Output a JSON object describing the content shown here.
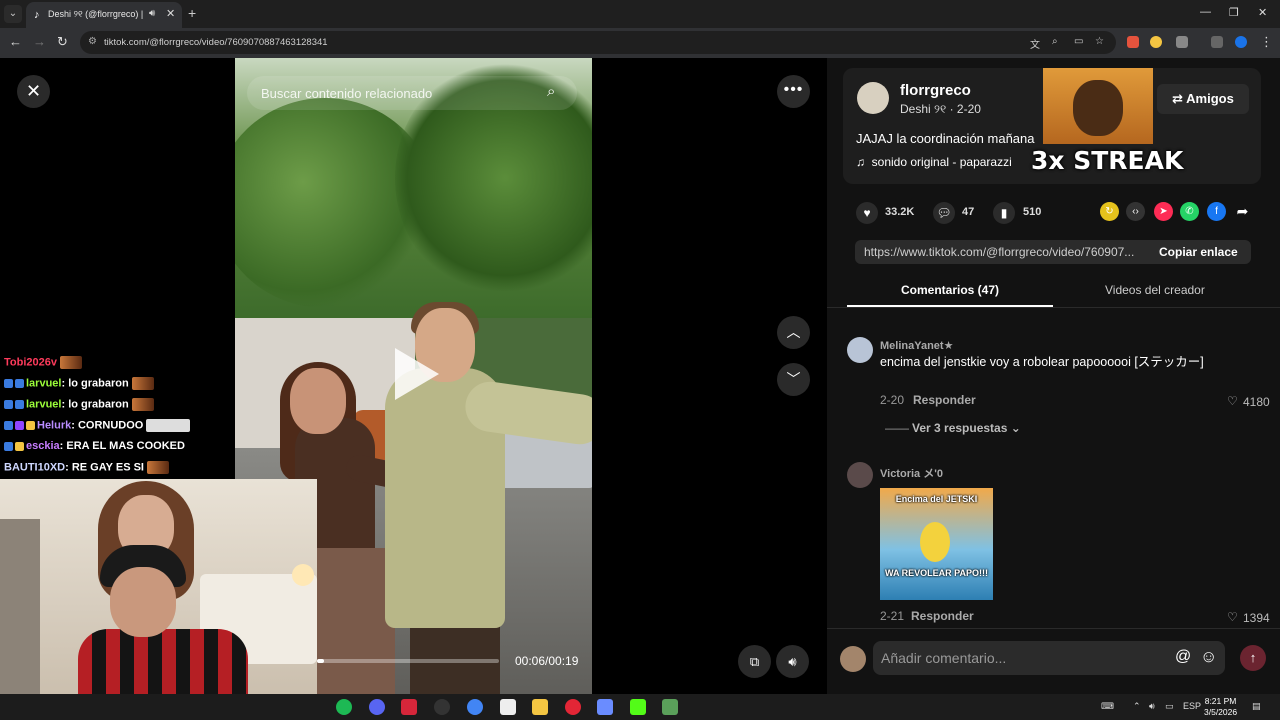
{
  "browser": {
    "tab_title": "Deshi ୨୧ (@florrgreco) | Tik",
    "url": "tiktok.com/@florrgreco/video/7609070887463128341"
  },
  "video": {
    "search_placeholder": "Buscar contenido relacionado",
    "time": "00:06/00:19",
    "progress_fraction": 0.04
  },
  "post": {
    "username": "florrgreco",
    "subline": "Deshi ୨୧ · 2-20",
    "friends_label": "Amigos",
    "caption": "JAJAJ la coordinación mañana",
    "sound": "sonido original - paparazzi",
    "likes": "33.2K",
    "comments": "47",
    "saves": "510",
    "link": "https://www.tiktok.com/@florrgreco/video/760907...",
    "copy_label": "Copiar enlace"
  },
  "overlay": {
    "streak": "3x STREAK"
  },
  "tabs": {
    "comments": "Comentarios (47)",
    "videos": "Videos del creador"
  },
  "comments": [
    {
      "user": "MelinaYanet★",
      "text": "encima del jenstkie voy a robolear papoooooi [ステッカー]",
      "date": "2-20",
      "reply": "Responder",
      "likes": "4180",
      "replies_label": "Ver 3 respuestas"
    },
    {
      "user": "Victoria メ'0",
      "meme_top": "Encima del JETSKI",
      "meme_bottom": "WA REVOLEAR PAPO!!!",
      "date": "2-21",
      "reply": "Responder",
      "likes": "1394"
    }
  ],
  "composer": {
    "placeholder": "Añadir comentario..."
  },
  "chat": [
    {
      "user": "Tobi2026v",
      "msg": "",
      "color": "#ff3b5c"
    },
    {
      "user": "larvuel",
      "msg": ": lo grabaron",
      "color": "#9cff3a"
    },
    {
      "user": "larvuel",
      "msg": ": lo grabaron",
      "color": "#9cff3a"
    },
    {
      "user": "Helurk",
      "msg": ": CORNUDOO",
      "color": "#b98cff"
    },
    {
      "user": "esckia",
      "msg": ": ERA EL MAS COOKED",
      "color": "#c77dff"
    },
    {
      "user": "BAUTI10XD",
      "msg": ": RE GAY ES SI",
      "color": "#cfd8ff"
    }
  ],
  "taskbar": {
    "lang": "ESP",
    "time": "8:21 PM",
    "date": "3/5/2026"
  },
  "colors": {
    "accent": "#fe2c55",
    "panel_bg": "#121212"
  }
}
